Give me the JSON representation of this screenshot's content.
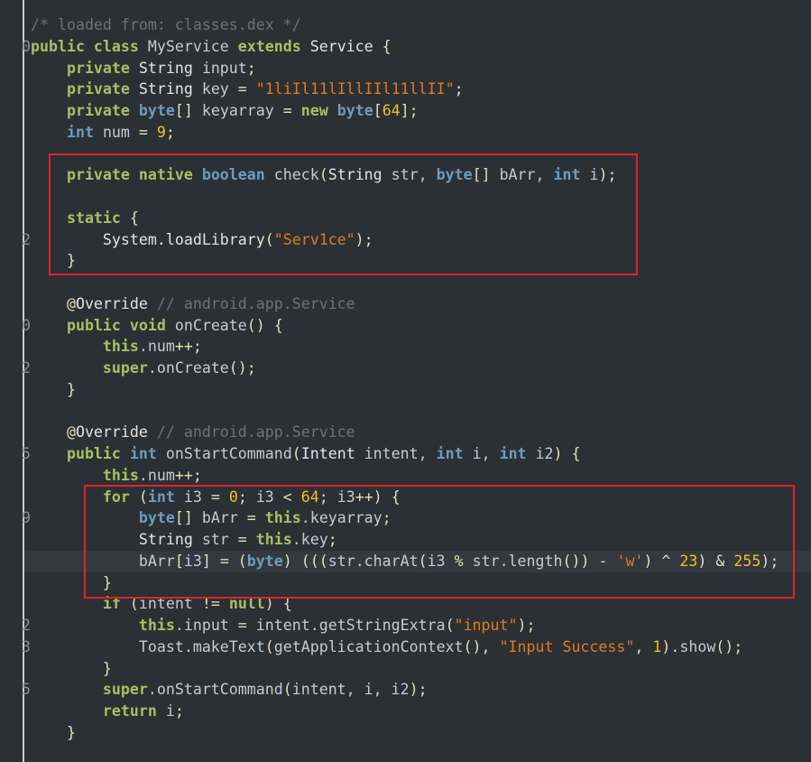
{
  "editor": {
    "highlighted_line": 25,
    "colors": {
      "keyword": "#a5c261",
      "type": "#6d9cbe",
      "string": "#e07b1f",
      "number": "#f2c21b",
      "comment": "#6b737b",
      "highlight_box": "#e5202a"
    },
    "lines": [
      {
        "g": "",
        "tokens": [
          [
            "/* loaded from: classes.dex */",
            "c"
          ]
        ]
      },
      {
        "g": "0",
        "tokens": [
          [
            "public class ",
            "k"
          ],
          [
            "MyService ",
            "i"
          ],
          [
            "extends ",
            "k"
          ],
          [
            "Service ",
            "w"
          ],
          [
            "{",
            "p"
          ]
        ]
      },
      {
        "g": "",
        "tokens": [
          [
            "    private ",
            "k"
          ],
          [
            "String ",
            "w"
          ],
          [
            "input",
            "i"
          ],
          [
            ";",
            "p"
          ]
        ]
      },
      {
        "g": "",
        "tokens": [
          [
            "    private ",
            "k"
          ],
          [
            "String ",
            "w"
          ],
          [
            "key ",
            "i"
          ],
          [
            "= ",
            "p"
          ],
          [
            "\"1liIl11lIllIIl11llII\"",
            "s"
          ],
          [
            ";",
            "p"
          ]
        ]
      },
      {
        "g": "",
        "tokens": [
          [
            "    private ",
            "k"
          ],
          [
            "byte",
            "t"
          ],
          [
            "[] ",
            "p"
          ],
          [
            "keyarray ",
            "i"
          ],
          [
            "= ",
            "p"
          ],
          [
            "new ",
            "k"
          ],
          [
            "byte",
            "t"
          ],
          [
            "[",
            "p"
          ],
          [
            "64",
            "n"
          ],
          [
            "];",
            "p"
          ]
        ]
      },
      {
        "g": "",
        "tokens": [
          [
            "    int ",
            "t"
          ],
          [
            "num ",
            "i"
          ],
          [
            "= ",
            "p"
          ],
          [
            "9",
            "n"
          ],
          [
            ";",
            "p"
          ]
        ]
      },
      {
        "g": "",
        "tokens": []
      },
      {
        "g": "",
        "tokens": [
          [
            "    private native ",
            "k"
          ],
          [
            "boolean ",
            "t"
          ],
          [
            "check",
            "i"
          ],
          [
            "(",
            "p"
          ],
          [
            "String ",
            "w"
          ],
          [
            "str, ",
            "i"
          ],
          [
            "byte",
            "t"
          ],
          [
            "[] ",
            "p"
          ],
          [
            "bArr, ",
            "i"
          ],
          [
            "int ",
            "t"
          ],
          [
            "i",
            "i"
          ],
          [
            ");",
            "p"
          ]
        ]
      },
      {
        "g": "",
        "tokens": []
      },
      {
        "g": "",
        "tokens": [
          [
            "    static ",
            "k"
          ],
          [
            "{",
            "p"
          ]
        ]
      },
      {
        "g": "2",
        "tokens": [
          [
            "        System.loadLibrary",
            "w"
          ],
          [
            "(",
            "p"
          ],
          [
            "\"Serv1ce\"",
            "s"
          ],
          [
            ");",
            "p"
          ]
        ]
      },
      {
        "g": "",
        "tokens": [
          [
            "    }",
            "p"
          ]
        ]
      },
      {
        "g": "",
        "tokens": []
      },
      {
        "g": "",
        "tokens": [
          [
            "    @",
            "p"
          ],
          [
            "Override ",
            "w"
          ],
          [
            "// android.app.Service",
            "c"
          ]
        ]
      },
      {
        "g": "0",
        "tokens": [
          [
            "    public void ",
            "k"
          ],
          [
            "onCreate",
            "i"
          ],
          [
            "() {",
            "p"
          ]
        ]
      },
      {
        "g": "",
        "tokens": [
          [
            "        this",
            "k"
          ],
          [
            ".num",
            "i"
          ],
          [
            "++;",
            "p"
          ]
        ]
      },
      {
        "g": "2",
        "tokens": [
          [
            "        super",
            "k"
          ],
          [
            ".onCreate",
            "i"
          ],
          [
            "();",
            "p"
          ]
        ]
      },
      {
        "g": "",
        "tokens": [
          [
            "    }",
            "p"
          ]
        ]
      },
      {
        "g": "",
        "tokens": []
      },
      {
        "g": "",
        "tokens": [
          [
            "    @",
            "p"
          ],
          [
            "Override ",
            "w"
          ],
          [
            "// android.app.Service",
            "c"
          ]
        ]
      },
      {
        "g": "5",
        "tokens": [
          [
            "    public ",
            "k"
          ],
          [
            "int ",
            "t"
          ],
          [
            "onStartCommand",
            "i"
          ],
          [
            "(",
            "p"
          ],
          [
            "Intent ",
            "w"
          ],
          [
            "intent, ",
            "i"
          ],
          [
            "int ",
            "t"
          ],
          [
            "i, ",
            "i"
          ],
          [
            "int ",
            "t"
          ],
          [
            "i2",
            "i"
          ],
          [
            ") {",
            "p"
          ]
        ]
      },
      {
        "g": "",
        "tokens": [
          [
            "        this",
            "k"
          ],
          [
            ".num",
            "i"
          ],
          [
            "++;",
            "p"
          ]
        ]
      },
      {
        "g": "",
        "tokens": [
          [
            "        for ",
            "k"
          ],
          [
            "(",
            "p"
          ],
          [
            "int ",
            "t"
          ],
          [
            "i3 ",
            "i"
          ],
          [
            "= ",
            "p"
          ],
          [
            "0",
            "n"
          ],
          [
            "; ",
            "p"
          ],
          [
            "i3 ",
            "i"
          ],
          [
            "< ",
            "p"
          ],
          [
            "64",
            "n"
          ],
          [
            "; ",
            "p"
          ],
          [
            "i3",
            "i"
          ],
          [
            "++) {",
            "p"
          ]
        ]
      },
      {
        "g": "9",
        "tokens": [
          [
            "            byte",
            "t"
          ],
          [
            "[] ",
            "p"
          ],
          [
            "bArr ",
            "i"
          ],
          [
            "= ",
            "p"
          ],
          [
            "this",
            "k"
          ],
          [
            ".keyarray",
            "i"
          ],
          [
            ";",
            "p"
          ]
        ]
      },
      {
        "g": "",
        "tokens": [
          [
            "            String ",
            "w"
          ],
          [
            "str ",
            "i"
          ],
          [
            "= ",
            "p"
          ],
          [
            "this",
            "k"
          ],
          [
            ".key",
            "i"
          ],
          [
            ";",
            "p"
          ]
        ]
      },
      {
        "g": "",
        "tokens": [
          [
            "            bArr",
            "i"
          ],
          [
            "[",
            "p"
          ],
          [
            "i3",
            "i"
          ],
          [
            "] = (",
            "p"
          ],
          [
            "byte",
            "t"
          ],
          [
            ") (((",
            "p"
          ],
          [
            "str.charAt",
            "i"
          ],
          [
            "(",
            "p"
          ],
          [
            "i3 ",
            "i"
          ],
          [
            "% ",
            "p"
          ],
          [
            "str.length",
            "i"
          ],
          [
            "()) - ",
            "p"
          ],
          [
            "'w'",
            "s"
          ],
          [
            ") ^ ",
            "p"
          ],
          [
            "23",
            "n"
          ],
          [
            ") & ",
            "p"
          ],
          [
            "255",
            "n"
          ],
          [
            ");",
            "p"
          ]
        ]
      },
      {
        "g": "",
        "tokens": [
          [
            "        }",
            "p"
          ]
        ]
      },
      {
        "g": "",
        "tokens": [
          [
            "        if ",
            "k"
          ],
          [
            "(",
            "p"
          ],
          [
            "intent ",
            "i"
          ],
          [
            "!= ",
            "p"
          ],
          [
            "null",
            "k"
          ],
          [
            ") {",
            "p"
          ]
        ]
      },
      {
        "g": "2",
        "tokens": [
          [
            "            this",
            "k"
          ],
          [
            ".input ",
            "i"
          ],
          [
            "= ",
            "p"
          ],
          [
            "intent.getStringExtra",
            "i"
          ],
          [
            "(",
            "p"
          ],
          [
            "\"input\"",
            "s"
          ],
          [
            ");",
            "p"
          ]
        ]
      },
      {
        "g": "3",
        "tokens": [
          [
            "            Toast.makeText",
            "i"
          ],
          [
            "(",
            "p"
          ],
          [
            "getApplicationContext",
            "i"
          ],
          [
            "(), ",
            "p"
          ],
          [
            "\"Input Success\"",
            "s"
          ],
          [
            ", ",
            "p"
          ],
          [
            "1",
            "n"
          ],
          [
            ").",
            "p"
          ],
          [
            "show",
            "i"
          ],
          [
            "();",
            "p"
          ]
        ]
      },
      {
        "g": "",
        "tokens": [
          [
            "        }",
            "p"
          ]
        ]
      },
      {
        "g": "5",
        "tokens": [
          [
            "        super",
            "k"
          ],
          [
            ".onStartCommand",
            "i"
          ],
          [
            "(",
            "p"
          ],
          [
            "intent, i, i2",
            "i"
          ],
          [
            ");",
            "p"
          ]
        ]
      },
      {
        "g": "",
        "tokens": [
          [
            "        return ",
            "k"
          ],
          [
            "i",
            "i"
          ],
          [
            ";",
            "p"
          ]
        ]
      },
      {
        "g": "",
        "tokens": [
          [
            "    }",
            "p"
          ]
        ]
      }
    ]
  }
}
